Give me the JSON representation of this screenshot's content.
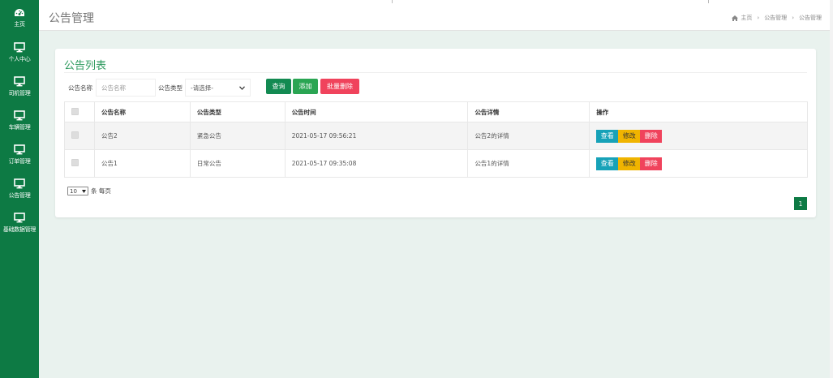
{
  "sidebar": {
    "items": [
      {
        "label": "主页",
        "icon": "dashboard-icon"
      },
      {
        "label": "个人中心",
        "icon": "monitor-icon"
      },
      {
        "label": "司机管理",
        "icon": "monitor-icon"
      },
      {
        "label": "车辆管理",
        "icon": "monitor-icon"
      },
      {
        "label": "订单管理",
        "icon": "monitor-icon"
      },
      {
        "label": "公告管理",
        "icon": "monitor-icon"
      },
      {
        "label": "基础数据管理",
        "icon": "monitor-icon"
      }
    ]
  },
  "header": {
    "title": "公告管理",
    "breadcrumb": {
      "home": "主页",
      "parent": "公告管理",
      "current": "公告管理",
      "separator": "›"
    }
  },
  "card": {
    "title": "公告列表",
    "filters": {
      "name_label": "公告名称",
      "name_placeholder": "公告名称",
      "type_label": "公告类型",
      "type_selected": "-请选择-"
    },
    "buttons": {
      "search": "查询",
      "add": "添加",
      "batch_delete": "批量删除"
    },
    "table": {
      "headers": [
        "公告名称",
        "公告类型",
        "公告时间",
        "公告详情",
        "操作"
      ],
      "rows": [
        {
          "name": "公告2",
          "type": "紧急公告",
          "time": "2021-05-17 09:56:21",
          "detail": "公告2的详情"
        },
        {
          "name": "公告1",
          "type": "日常公告",
          "time": "2021-05-17 09:35:08",
          "detail": "公告1的详情"
        }
      ],
      "actions": {
        "view": "查看",
        "edit": "修改",
        "delete": "删除"
      }
    },
    "page_size": {
      "value": "10",
      "suffix": "条 每页"
    },
    "pagination": {
      "current": "1"
    }
  },
  "colors": {
    "sidebar": "#0d7a44",
    "accent": "#2e9b5f",
    "danger": "#f0435c",
    "info": "#17a2b8",
    "warning": "#f0b400"
  }
}
